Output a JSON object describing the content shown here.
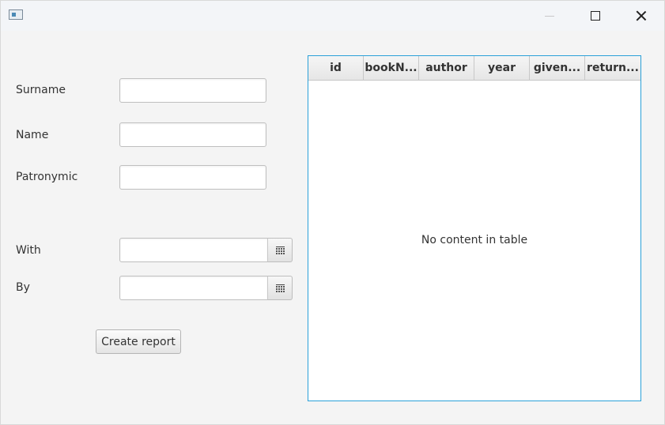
{
  "window": {
    "title": "",
    "controls": {
      "minimize": "minimize-icon",
      "maximize": "maximize-icon",
      "close": "close-icon"
    }
  },
  "form": {
    "surname_label": "Surname",
    "surname_value": "",
    "name_label": "Name",
    "name_value": "",
    "patronymic_label": "Patronymic",
    "patronymic_value": "",
    "with_label": "With",
    "with_value": "",
    "by_label": "By",
    "by_value": "",
    "date_picker_icon": "calendar-icon",
    "create_report_label": "Create report"
  },
  "table": {
    "columns": [
      "id",
      "bookN...",
      "author",
      "year",
      "given...",
      "return..."
    ],
    "rows": [],
    "empty_text": "No content in table",
    "focus_border_color": "#2aa0d8"
  }
}
